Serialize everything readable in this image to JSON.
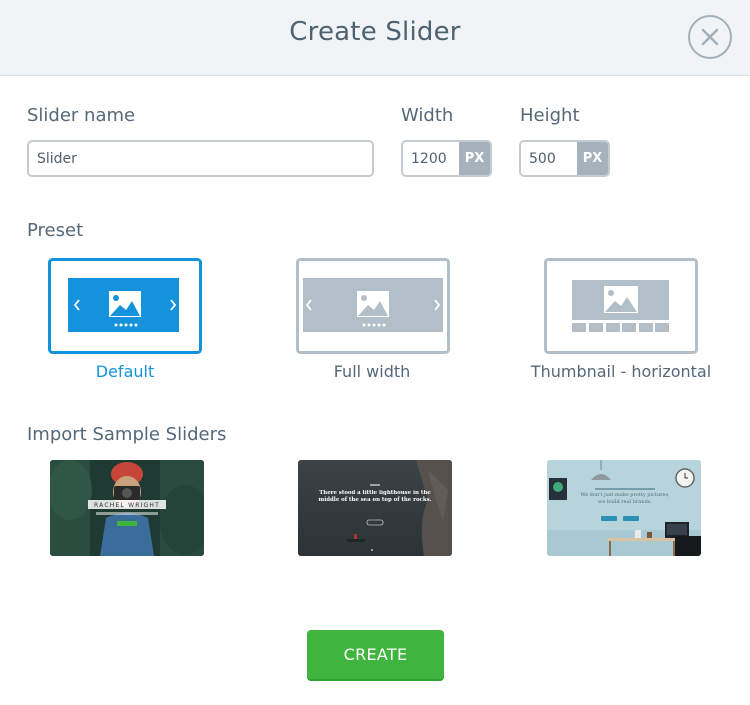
{
  "dialog": {
    "title": "Create Slider"
  },
  "form": {
    "name_label": "Slider name",
    "name_value": "Slider",
    "width_label": "Width",
    "width_value": "1200",
    "width_unit": "PX",
    "height_label": "Height",
    "height_value": "500",
    "height_unit": "PX"
  },
  "preset": {
    "section_label": "Preset",
    "selected": "Default",
    "items": [
      {
        "label": "Default",
        "icon": "slider-arrows-dots-icon",
        "active": true
      },
      {
        "label": "Full width",
        "icon": "full-width-slider-icon",
        "active": false
      },
      {
        "label": "Thumbnail - horizontal",
        "icon": "thumbnail-horizontal-slider-icon",
        "active": false
      }
    ]
  },
  "samples": {
    "section_label": "Import Sample Sliders",
    "items": [
      {
        "name": "photographer-sample",
        "overlay_text": "RACHEL WRIGHT"
      },
      {
        "name": "lighthouse-sample",
        "overlay_text": "There stood a little lighthouse in the middle of the sea on top of the rocks."
      },
      {
        "name": "agency-sample",
        "overlay_text": "We don't just make pretty pictures, we build real brands."
      }
    ]
  },
  "actions": {
    "create_label": "CREATE"
  },
  "colors": {
    "accent_blue": "#1493dc",
    "create_green": "#3fb43e",
    "muted_gray": "#b3bfc8"
  }
}
